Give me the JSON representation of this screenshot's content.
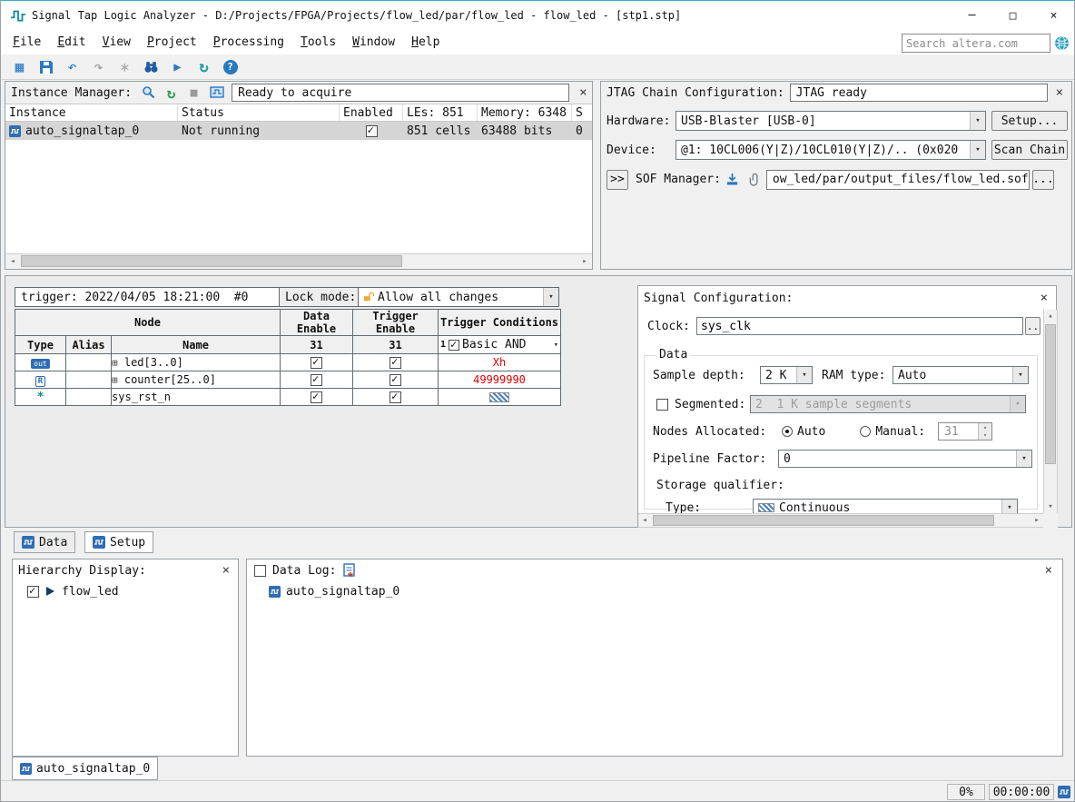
{
  "window": {
    "title": "Signal Tap Logic Analyzer - D:/Projects/FPGA/Projects/flow_led/par/flow_led - flow_led - [stp1.stp]"
  },
  "menu": {
    "items": [
      "File",
      "Edit",
      "View",
      "Project",
      "Processing",
      "Tools",
      "Window",
      "Help"
    ]
  },
  "search": {
    "placeholder": "Search altera.com"
  },
  "icons": {
    "minimize": "─",
    "maximize": "□",
    "close": "×",
    "grid": "▦",
    "undo": "↶",
    "redo": "↷",
    "asterisk": "∗",
    "run": "▶",
    "loop": "↻",
    "autorun": "↻",
    "stop": "■",
    "help": "?",
    "dropdown": "▾",
    "expand": "⊞",
    "left": "◂",
    "right": "▸",
    "up": "▴",
    "down": "▾"
  },
  "colors": {
    "accent": "#2b79c2",
    "condition_red": "#e00000",
    "selected_row": "#d5d5d5",
    "title_accent": "#35b2c4"
  },
  "instance_manager": {
    "label": "Instance Manager:",
    "status": "Ready to acquire",
    "columns": [
      "Instance",
      "Status",
      "Enabled",
      "LEs: 851",
      "Memory: 6348",
      "S"
    ],
    "row": {
      "name": "auto_signaltap_0",
      "status": "Not running",
      "les": "851 cells",
      "memory": "63488 bits",
      "small": "0"
    }
  },
  "jtag": {
    "label": "JTAG Chain Configuration:",
    "status": "JTAG ready",
    "hardware_label": "Hardware:",
    "hardware_value": "USB-Blaster [USB-0]",
    "setup_button": "Setup...",
    "device_label": "Device:",
    "device_value": "@1: 10CL006(Y|Z)/10CL010(Y|Z)/.. (0x020",
    "scan_button": "Scan Chain",
    "expand_button": ">>",
    "sof_label": "SOF Manager:",
    "sof_path": "ow_led/par/output_files/flow_led.sof",
    "browse_button": "..."
  },
  "setup": {
    "trigger": "trigger: 2022/04/05 18:21:00  #0",
    "lock_label": "Lock mode:",
    "lock_value": "Allow all changes",
    "node_header": "Node",
    "col_data_enable": "Data Enable",
    "col_trigger_enable": "Trigger Enable",
    "col_trigger_conditions": "Trigger Conditions",
    "col_type": "Type",
    "col_alias": "Alias",
    "col_name": "Name",
    "data_enable_count": "31",
    "trigger_enable_count": "31",
    "condition_index": "1",
    "condition_mode": "Basic AND",
    "rows": [
      {
        "type_icon": "out",
        "name": "led[3..0]",
        "condition": "Xh"
      },
      {
        "type_icon": "R",
        "name": "counter[25..0]",
        "condition": "49999990"
      },
      {
        "type_icon": "*",
        "name": "sys_rst_n",
        "condition": ""
      }
    ]
  },
  "signal_config": {
    "title": "Signal Configuration:",
    "clock_label": "Clock:",
    "clock_value": "sys_clk",
    "clock_browse": "..",
    "data_group": "Data",
    "sample_depth_label": "Sample depth:",
    "sample_depth_value": "2 K",
    "ram_type_label": "RAM type:",
    "ram_type_value": "Auto",
    "segmented_label": "Segmented:",
    "segmented_value": "2  1 K sample segments",
    "nodes_label": "Nodes Allocated:",
    "auto_label": "Auto",
    "manual_label": "Manual:",
    "manual_value": "31",
    "pipeline_label": "Pipeline Factor:",
    "pipeline_value": "0",
    "storage_label": "Storage qualifier:",
    "type_label": "Type:",
    "type_value": "Continuous"
  },
  "tabs": {
    "data": "Data",
    "setup": "Setup"
  },
  "hierarchy": {
    "title": "Hierarchy Display:",
    "item": "flow_led"
  },
  "data_log": {
    "label": "Data Log:",
    "item": "auto_signaltap_0"
  },
  "bottom_tab": {
    "label": "auto_signaltap_0"
  },
  "status": {
    "progress": "0%",
    "time": "00:00:00"
  }
}
